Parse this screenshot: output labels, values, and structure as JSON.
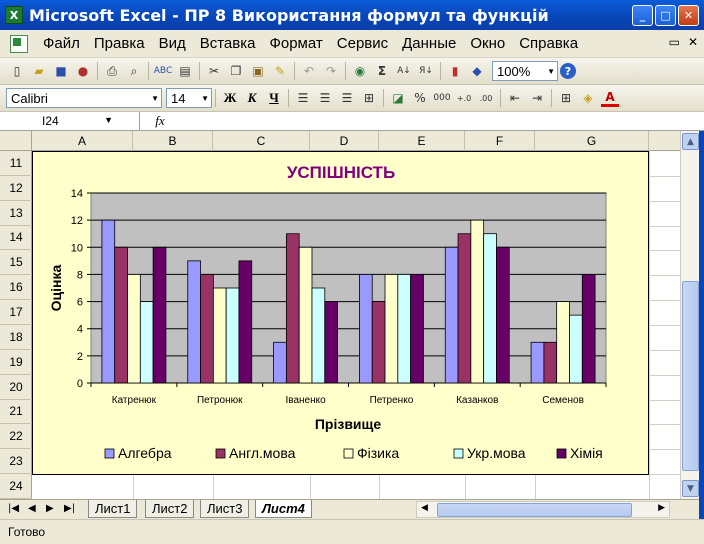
{
  "window": {
    "title": "Microsoft Excel - ПР 8 Використання формул та функцій",
    "app_icon": "X"
  },
  "menu": [
    "Файл",
    "Правка",
    "Вид",
    "Вставка",
    "Формат",
    "Сервис",
    "Данные",
    "Окно",
    "Справка"
  ],
  "toolbar": {
    "zoom": "100%",
    "font": "Calibri",
    "font_size": "14",
    "bold": "Ж",
    "italic": "К",
    "underline": "Ч",
    "percent": "%",
    "thousands": "000",
    "sigma": "Σ"
  },
  "formula_bar": {
    "cell_ref": "I24",
    "fx": "fx",
    "value": ""
  },
  "columns": [
    "A",
    "B",
    "C",
    "D",
    "E",
    "F",
    "G"
  ],
  "rows": [
    "11",
    "12",
    "13",
    "14",
    "15",
    "16",
    "17",
    "18",
    "19",
    "20",
    "21",
    "22",
    "23",
    "24"
  ],
  "sheets": [
    "Лист1",
    "Лист2",
    "Лист3",
    "Лист4"
  ],
  "active_sheet": "Лист4",
  "status": "Готово",
  "colors": {
    "algebra": "#9999ff",
    "english": "#993366",
    "physics": "#ffffcc",
    "ukr": "#ccffff",
    "chem": "#660066",
    "plot_bg": "#c0c0c0",
    "title": "#800080"
  },
  "chart_data": {
    "type": "bar",
    "title": "УСПІШНІСТЬ",
    "xlabel": "Прізвище",
    "ylabel": "Оцінка",
    "ylim": [
      0,
      14
    ],
    "yticks": [
      0,
      2,
      4,
      6,
      8,
      10,
      12,
      14
    ],
    "grid": true,
    "legend_position": "bottom",
    "categories": [
      "Катренюк",
      "Петронюк",
      "Іваненко",
      "Петренко",
      "Казанков",
      "Семенов"
    ],
    "series": [
      {
        "name": "Алгебра",
        "values": [
          12,
          9,
          3,
          8,
          10,
          3
        ]
      },
      {
        "name": "Англ.мова",
        "values": [
          10,
          8,
          11,
          6,
          11,
          3
        ]
      },
      {
        "name": "Фізика",
        "values": [
          8,
          7,
          10,
          8,
          12,
          6
        ]
      },
      {
        "name": "Укр.мова",
        "values": [
          6,
          7,
          7,
          8,
          11,
          5
        ]
      },
      {
        "name": "Хімія",
        "values": [
          10,
          9,
          6,
          8,
          10,
          8
        ]
      }
    ]
  }
}
